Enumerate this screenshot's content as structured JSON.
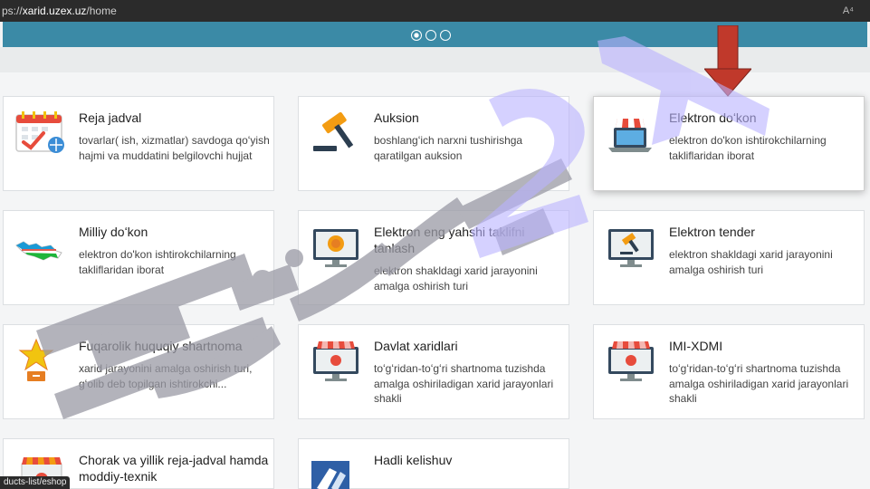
{
  "browser": {
    "url_prefix": "ps://",
    "url_host": "xarid.uzex.uz",
    "url_path": "/home",
    "read_mode_label": "A⁴"
  },
  "status_link": "ducts-list/eshop",
  "watermark_text": "Hujjat24",
  "cards": [
    {
      "title": "Reja jadval",
      "desc": "tovarlar( ish, xizmatlar) savdoga qoʻyish hajmi va muddatini belgilovchi hujjat",
      "icon": "calendar-icon"
    },
    {
      "title": "Auksion",
      "desc": "boshlangʻich narxni tushirishga qaratilgan auksion",
      "icon": "gavel-icon"
    },
    {
      "title": "Elektron doʻkon",
      "desc": "elektron do'kon ishtirokchilarning takliflaridan iborat",
      "icon": "shop-laptop-icon"
    },
    {
      "title": "Milliy doʻkon",
      "desc": "elektron do'kon ishtirokchilarning takliflaridan iborat",
      "icon": "uzbekistan-map-icon"
    },
    {
      "title": "Elektron eng yahshi taklifni tanlash",
      "desc": "elektron shakldagi xarid jarayonini amalga oshirish turi",
      "icon": "award-monitor-icon"
    },
    {
      "title": "Elektron tender",
      "desc": "elektron shakldagi xarid jarayonini amalga oshirish turi",
      "icon": "gavel-monitor-icon"
    },
    {
      "title": "Fuqarolik huquqiy shartnoma",
      "desc": "xarid jarayonini amalga oshirish turi, gʻolib deb topilgan ishtirokchi...",
      "icon": "star-icon"
    },
    {
      "title": "Davlat xaridlari",
      "desc": "toʻgʻridan-toʻgʻri shartnoma tuzishda amalga oshiriladigan xarid jarayonlari shakli",
      "icon": "store-monitor-icon"
    },
    {
      "title": "IMI-XDMI",
      "desc": "toʻgʻridan-toʻgʻri shartnoma tuzishda amalga oshiriladigan xarid jarayonlari shakli",
      "icon": "store-monitor-icon"
    },
    {
      "title": "Chorak va yillik reja-jadval hamda moddiy-texnik",
      "desc": "",
      "icon": "store-icon"
    },
    {
      "title": "Hadli kelishuv",
      "desc": "",
      "icon": "handshake-logo-icon"
    }
  ],
  "colors": {
    "banner": "#3b8aa6",
    "watermark": "#b9b2ff",
    "watermark_gray": "#8a8a8a",
    "arrow": "#c0392b"
  }
}
